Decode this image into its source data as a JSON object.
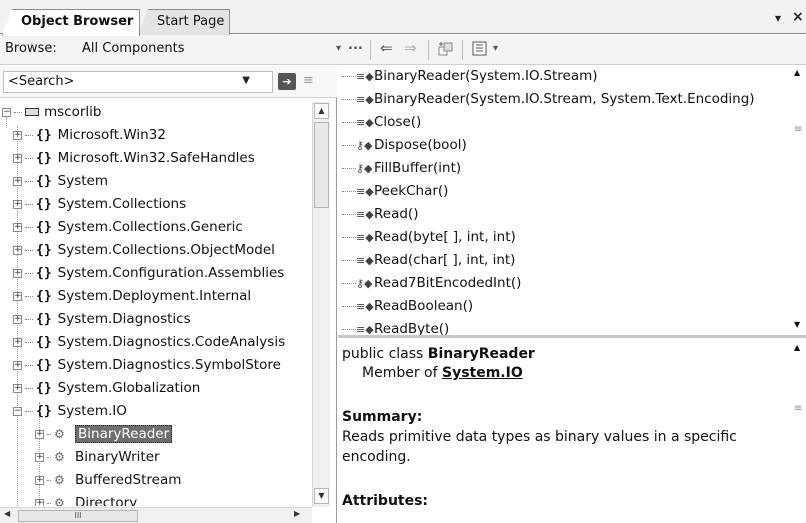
{
  "tabs": [
    {
      "label": "Object Browser",
      "active": true
    },
    {
      "label": "Start Page",
      "active": false
    }
  ],
  "tab_controls": {
    "dropdown": "▾",
    "close": "×"
  },
  "browse": {
    "label": "Browse:",
    "value": "All Components",
    "dropdown": "▾",
    "more": "...",
    "back": "⇐",
    "forward": "⇒"
  },
  "search": {
    "placeholder": "<Search>",
    "value": "<Search>"
  },
  "tree": {
    "root": "mscorlib",
    "namespaces": [
      "Microsoft.Win32",
      "Microsoft.Win32.SafeHandles",
      "System",
      "System.Collections",
      "System.Collections.Generic",
      "System.Collections.ObjectModel",
      "System.Configuration.Assemblies",
      "System.Deployment.Internal",
      "System.Diagnostics",
      "System.Diagnostics.CodeAnalysis",
      "System.Diagnostics.SymbolStore",
      "System.Globalization",
      "System.IO"
    ],
    "classes": [
      "BinaryReader",
      "BinaryWriter",
      "BufferedStream",
      "Directory"
    ],
    "selected": "BinaryReader",
    "hscroll_grip": "III"
  },
  "members": [
    {
      "label": "BinaryReader(System.IO.Stream)",
      "kind": "public-method-icon"
    },
    {
      "label": "BinaryReader(System.IO.Stream, System.Text.Encoding)",
      "kind": "public-method-icon"
    },
    {
      "label": "Close()",
      "kind": "public-method-icon"
    },
    {
      "label": "Dispose(bool)",
      "kind": "protected-method-icon"
    },
    {
      "label": "FillBuffer(int)",
      "kind": "protected-method-icon"
    },
    {
      "label": "PeekChar()",
      "kind": "public-method-icon"
    },
    {
      "label": "Read()",
      "kind": "public-method-icon"
    },
    {
      "label": "Read(byte[ ], int, int)",
      "kind": "public-method-icon"
    },
    {
      "label": "Read(char[ ], int, int)",
      "kind": "public-method-icon"
    },
    {
      "label": "Read7BitEncodedInt()",
      "kind": "protected-method-icon"
    },
    {
      "label": "ReadBoolean()",
      "kind": "public-method-icon"
    },
    {
      "label": "ReadByte()",
      "kind": "public-method-icon"
    }
  ],
  "description": {
    "prefix": "public class ",
    "class_name": "BinaryReader",
    "member_of_label": "Member of ",
    "member_of_link": "System.IO",
    "summary_heading": "Summary:",
    "summary_line1": "Reads primitive data types as binary values in a specific",
    "summary_line2": "encoding.",
    "attributes_heading": "Attributes:"
  }
}
